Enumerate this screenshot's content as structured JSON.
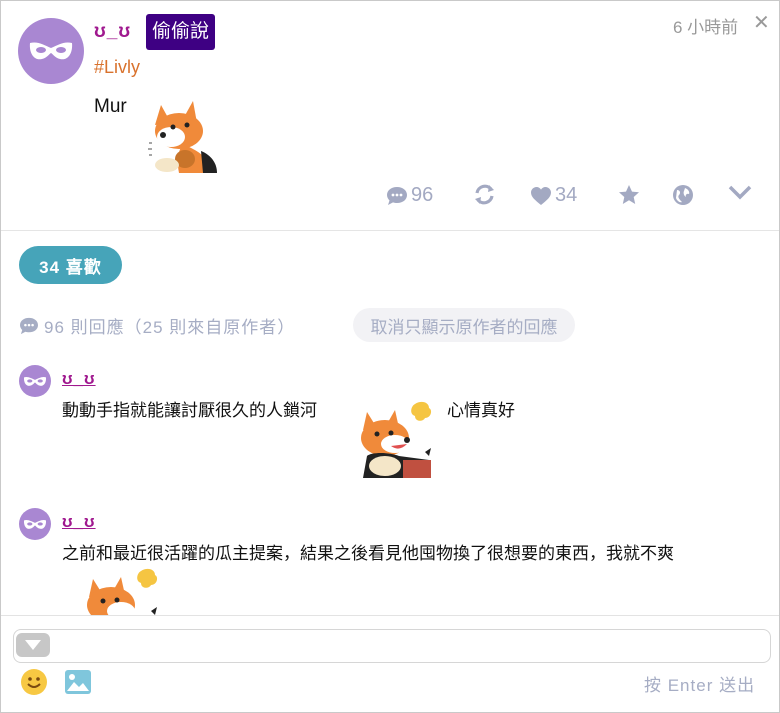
{
  "post": {
    "author": "ʊ_ʊ",
    "qualifier": "偷偷說",
    "tag": "#Livly",
    "time": "6 小時前",
    "content": "Mur"
  },
  "actions": {
    "responses": "96",
    "likes": "34"
  },
  "likes_button": "34 喜歡",
  "responses_info": {
    "count_text": "96 則回應（25 則來自原作者）",
    "filter_button": "取消只顯示原作者的回應"
  },
  "responses": [
    {
      "author": "ʊ_ʊ",
      "text_before": "動動手指就能讓討厭很久的人鎖河",
      "text_after": "心情真好"
    },
    {
      "author": "ʊ_ʊ",
      "text": "之前和最近很活躍的瓜主提案，結果之後看見他囤物換了很想要的東西，我就不爽"
    }
  ],
  "composer": {
    "send_hint": "按 Enter 送出"
  },
  "colors": {
    "author": "#a0198f",
    "qualifier_bg": "#3e0083",
    "tag": "#d9722d",
    "likes_button": "#46a4b9",
    "icons": "#a3a9c2",
    "avatar": "#a987d2"
  },
  "icons": [
    "mask-icon",
    "close-icon",
    "comment-icon",
    "replurk-icon",
    "heart-icon",
    "star-icon",
    "globe-icon",
    "chevron-down-icon",
    "fox-sticker",
    "smiley-icon",
    "image-icon"
  ]
}
